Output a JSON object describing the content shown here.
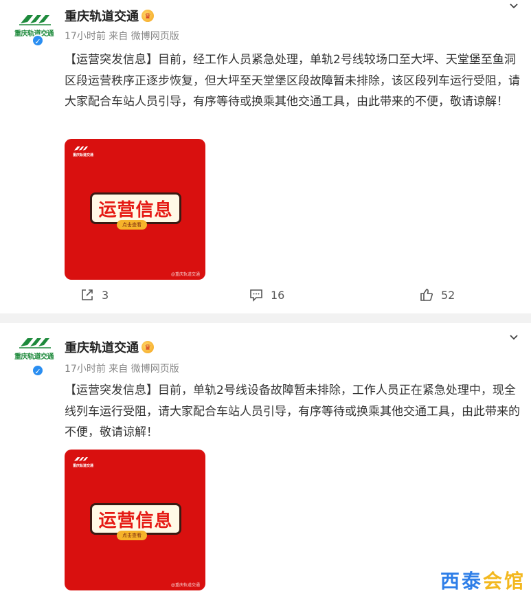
{
  "posts": [
    {
      "account_logo_text": "重庆轨道交通",
      "account_name": "重庆轨道交通",
      "meta": "17小时前  来自 微博网页版",
      "content": "【运营突发信息】目前，经工作人员紧急处理，单轨2号线较场口至大坪、天堂堡至鱼洞区段运营秩序正逐步恢复，但大坪至天堂堡区段故障暂未排除，该区段列车运行受阻，请大家配合车站人员引导，有序等待或换乘其他交通工具，由此带来的不便，敬请谅解！",
      "poster": {
        "logo_text": "重庆轨道交通",
        "title": "运营信息",
        "subtitle": "点击查看",
        "watermark": "@重庆轨道交通"
      },
      "repost_count": "3",
      "comment_count": "16",
      "like_count": "52"
    },
    {
      "account_logo_text": "重庆轨道交通",
      "account_name": "重庆轨道交通",
      "meta": "17小时前  来自 微博网页版",
      "content": "【运营突发信息】目前，单轨2号线设备故障暂未排除，工作人员正在紧急处理中，现全线列车运行受阻，请大家配合车站人员引导，有序等待或换乘其他交通工具，由此带来的不便，敬请谅解！",
      "poster": {
        "logo_text": "重庆轨道交通",
        "title": "运营信息",
        "subtitle": "点击查看",
        "watermark": "@重庆轨道交通"
      }
    }
  ],
  "site_watermark": [
    "西",
    "泰",
    "会",
    "馆"
  ],
  "colors": {
    "brand_green": "#1e8a3c",
    "poster_red": "#d9100f",
    "verified_blue": "#2a8ef1",
    "watermark_blue": "#2f7fe8",
    "watermark_yellow": "#f3b81f"
  },
  "icons": [
    "chevron-down-icon",
    "verified-icon",
    "crown-icon",
    "share-icon",
    "comment-icon",
    "like-icon"
  ]
}
